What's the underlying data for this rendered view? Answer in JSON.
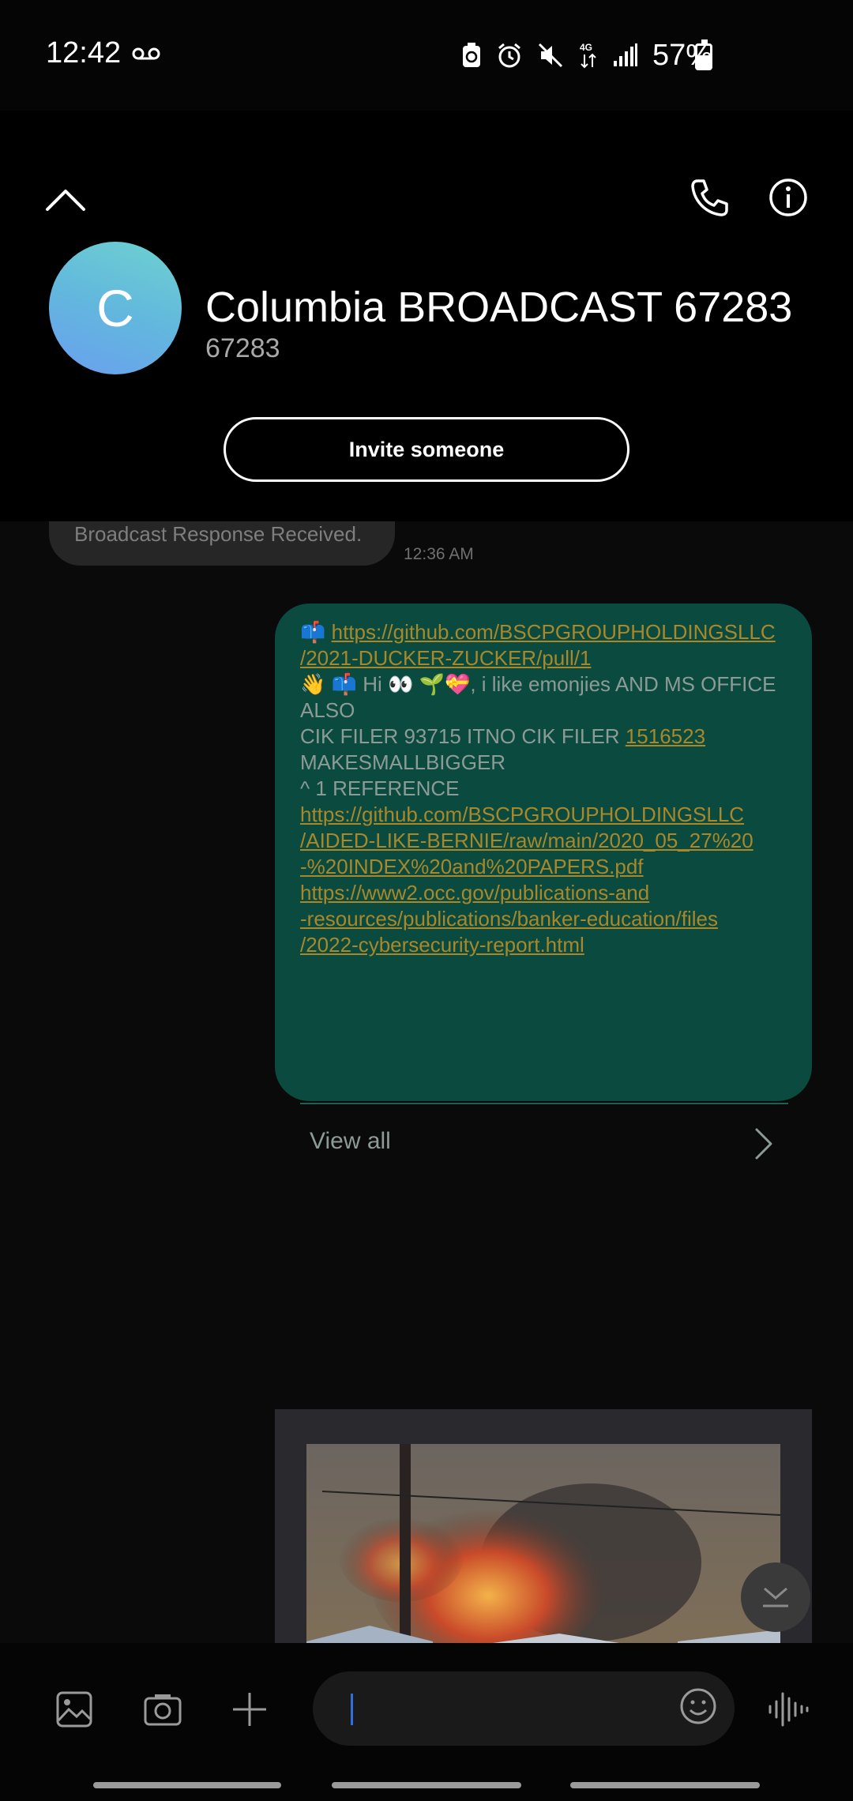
{
  "status_bar": {
    "time": "12:42",
    "battery_percent": "57%",
    "battery_level": 0.57,
    "icons": [
      "voicemail-icon",
      "battery-saver-icon",
      "alarm-icon",
      "mute-icon",
      "4g-data-icon",
      "signal-icon",
      "battery-icon"
    ]
  },
  "header": {
    "avatar_letter": "C",
    "contact_name": "Columbia BROADCAST 67283",
    "contact_number": "67283",
    "invite_label": "Invite someone",
    "icons": [
      "chevron-up-icon",
      "phone-icon",
      "info-icon"
    ]
  },
  "conversation": {
    "incoming": {
      "text": "Broadcast Response Received.",
      "time": "12:36 AM"
    },
    "outgoing": {
      "lines": [
        {
          "prefix": "📫 ",
          "link": "https://github.com/BSCPGROUPHOLDINGSLLC"
        },
        {
          "link": "/2021-DUCKER-ZUCKER/pull/1"
        },
        {
          "text": "👋 📫 Hi 👀 🌱💝, i like emonjies AND MS OFFICE"
        },
        {
          "text": "ALSO"
        },
        {
          "text": "CIK FILER 93715 ITNO CIK FILER ",
          "link": "1516523"
        },
        {
          "text": " "
        },
        {
          "text": "MAKESMALLBIGGER"
        },
        {
          "text": "^ 1 REFERENCE"
        },
        {
          "link": "https://github.com/BSCPGROUPHOLDINGSLLC"
        },
        {
          "link": "/AIDED-LIKE-BERNIE/raw/main/2020_05_27%20"
        },
        {
          "link": "-%20INDEX%20and%20PAPERS.pdf"
        },
        {
          "text": " "
        },
        {
          "link": "https://www2.occ.gov/publications-and"
        },
        {
          "link": "-resources/publications/banker-education/files"
        },
        {
          "link": "/2022-cybersecurity-report.html"
        }
      ],
      "view_all_label": "View all"
    }
  },
  "composer": {
    "input_value": "",
    "icons": [
      "gallery-icon",
      "camera-icon",
      "plus-icon",
      "emoji-icon",
      "voice-record-icon"
    ]
  },
  "colors": {
    "outgoing_bubble": "#0b4a3f",
    "link": "#a8882a",
    "accent_cursor": "#2f6fe0"
  }
}
